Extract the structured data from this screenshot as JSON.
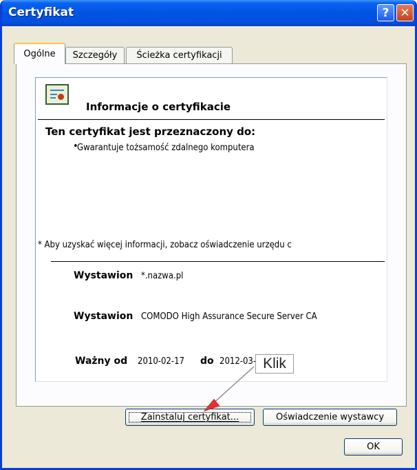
{
  "window": {
    "title": "Certyfikat",
    "help_glyph": "?",
    "close_glyph": "✕"
  },
  "tabs": [
    {
      "label": "Ogólne"
    },
    {
      "label": "Szczegóły"
    },
    {
      "label": "Ścieżka certyfikacji"
    }
  ],
  "info": {
    "heading": "Informacje o certyfikacie",
    "purpose_title": "Ten certyfikat jest przeznaczony do:",
    "purpose_items": [
      "Gwarantuje tożsamość zdalnego komputera"
    ],
    "note": "* Aby uzyskać więcej informacji, zobacz oświadczenie urzędu c",
    "issued_to_label": "Wystawion",
    "issued_to_value": "*.nazwa.pl",
    "issued_by_label": "Wystawion",
    "issued_by_value": "COMODO High Assurance Secure Server CA",
    "valid_from_label": "Ważny od",
    "valid_from_value": "2010-02-17",
    "valid_to_label": "do",
    "valid_to_value": "2012-03-19"
  },
  "buttons": {
    "install": "Zainstaluj certyfikat...",
    "statement": "Oświadczenie wystawcy",
    "ok": "OK"
  },
  "annotation": {
    "label": "Klik",
    "arrow_color": "#e03030"
  },
  "colors": {
    "titlebar": "#0054e3",
    "window_bg": "#ece9d8",
    "tab_highlight": "#ffc83c"
  }
}
